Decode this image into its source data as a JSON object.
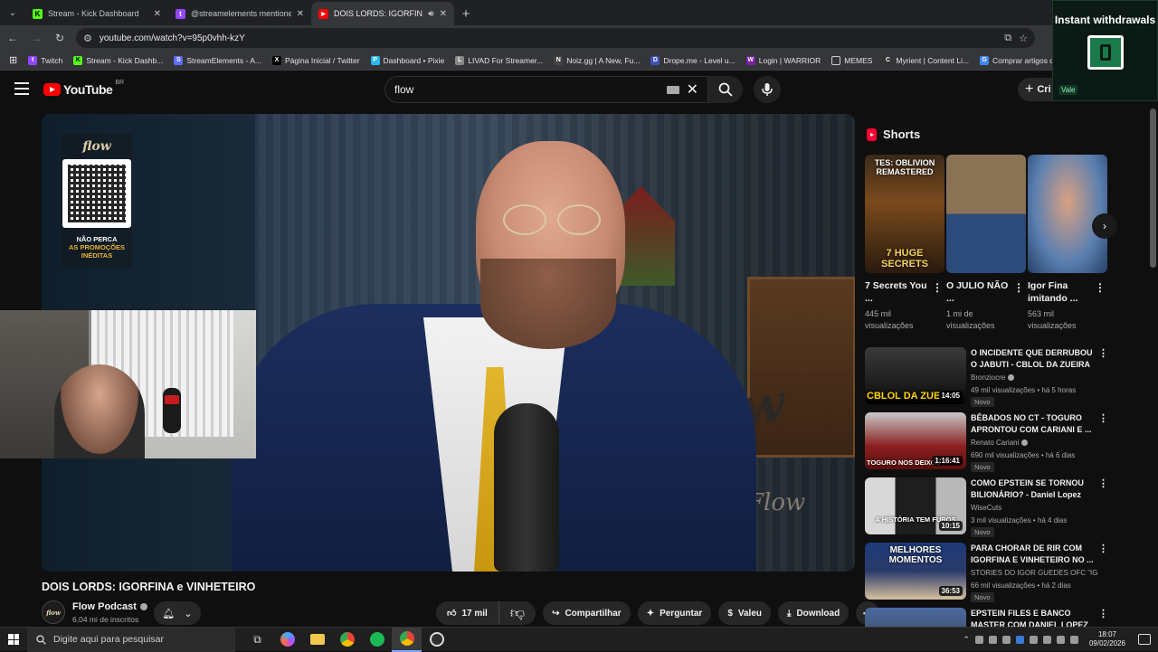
{
  "browser": {
    "tabs": [
      {
        "title": "Stream - Kick Dashboard",
        "icon": "kick-icon",
        "color": "#53fc18",
        "glyph": "K"
      },
      {
        "title": "@streamelements mentione",
        "icon": "twitch-icon",
        "color": "#9146ff",
        "glyph": "t"
      },
      {
        "title": "DOIS LORDS: IGORFINA e V",
        "icon": "youtube-icon",
        "color": "#ff0000",
        "glyph": "▶"
      }
    ],
    "url": "youtube.com/watch?v=95p0vhh-kzY",
    "bookmarks": [
      {
        "label": "Twitch",
        "color": "#9146ff",
        "glyph": "t"
      },
      {
        "label": "Stream - Kick Dashb...",
        "color": "#53fc18",
        "glyph": "K"
      },
      {
        "label": "StreamElements - A...",
        "color": "#5b6cff",
        "glyph": "S"
      },
      {
        "label": "Página Inicial / Twitter",
        "color": "#000000",
        "glyph": "X"
      },
      {
        "label": "Dashboard • Pixie",
        "color": "#29b6f6",
        "glyph": "P"
      },
      {
        "label": "LIVAD For Streamer...",
        "color": "#888888",
        "glyph": "L"
      },
      {
        "label": "Noiz.gg | A New, Fu...",
        "color": "#444444",
        "glyph": "N"
      },
      {
        "label": "Drope.me - Level u...",
        "color": "#3f51b5",
        "glyph": "D"
      },
      {
        "label": "Login | WARRIOR",
        "color": "#7b1fa2",
        "glyph": "W"
      },
      {
        "label": "MEMES",
        "color": "#5f6368",
        "glyph": "▭"
      },
      {
        "label": "Myrient | Content Li...",
        "color": "#333333",
        "glyph": "C"
      },
      {
        "label": "Comprar artigos de...",
        "color": "#4285f4",
        "glyph": "G"
      }
    ]
  },
  "youtube": {
    "logo": "YouTube",
    "country": "BR",
    "search_value": "flow",
    "create_label": "Cri"
  },
  "overlay": {
    "title": "Instant withdrawals",
    "tag": "Vale"
  },
  "video": {
    "promo_logo": "flow",
    "promo_line1": "NÃO PERCA",
    "promo_line2": "AS PROMOÇÕES",
    "promo_line3": "INÉDITAS",
    "watermark": "Flow",
    "title": "DOIS LORDS: IGORFINA e VINHETEIRO",
    "channel": "Flow Podcast",
    "channel_avatar": "flow",
    "subscribers": "6,04 mi de inscritos",
    "likes": "17 mil",
    "share": "Compartilhar",
    "ask": "Perguntar",
    "thanks": "Valeu",
    "download": "Download"
  },
  "sidebar": {
    "shorts_label": "Shorts",
    "shorts": [
      {
        "title": "7 Secrets You ...",
        "views_line1": "445 mil",
        "views_line2": "visualizações",
        "thumb_top": "TES: OBLIVION REMASTERED",
        "thumb_bottom": "7 HUGE SECRETS",
        "bg": "#7a4a1c"
      },
      {
        "title": "O JULIO NÃO ...",
        "views_line1": "1 mi de",
        "views_line2": "visualizações",
        "thumb_top": "",
        "thumb_bottom": "",
        "bg": "#6b5a3e"
      },
      {
        "title": "Igor Fina imitando ...",
        "views_line1": "563 mil",
        "views_line2": "visualizações",
        "thumb_top": "",
        "thumb_bottom": "",
        "bg": "#3a6aa0"
      }
    ],
    "videos": [
      {
        "title": "O INCIDENTE QUE DERRUBOU O JABUTI - CBLOL DA ZUEIRA",
        "channel": "Bronziocre",
        "verified": true,
        "views": "49 mil visualizações • há 5 horas",
        "badge": "Novo",
        "duration": "14:05",
        "thumb_text": "CBLOL DA ZUE",
        "bg": "#2a2a2a"
      },
      {
        "title": "BÊBADOS NO CT - TOGURO APRONTOU COM CARIANI E ...",
        "channel": "Renato Cariani",
        "verified": true,
        "views": "690 mil visualizações • há 6 dias",
        "badge": "Novo",
        "duration": "1:16:41",
        "thumb_text": "TOGURO NOS DEIXOU",
        "bg": "#8a1f1f"
      },
      {
        "title": "COMO EPSTEIN SE TORNOU BILIONÁRIO? - Daniel Lopez",
        "channel": "WiseCuts",
        "verified": false,
        "views": "3 mil visualizações • há 4 dias",
        "badge": "Novo",
        "duration": "10:15",
        "thumb_text": "A HISTÓRIA TEM FUROS",
        "bg": "#1e1e1e"
      },
      {
        "title": "PARA CHORAR DE RIR COM IGORFINA E VINHETEIRO NO ...",
        "channel": "STORIES DO IGOR GUEDES OFC \"IGORFI...",
        "verified": false,
        "views": "66 mil visualizações • há 2 dias",
        "badge": "Novo",
        "duration": "36:53",
        "thumb_text": "MELHORES MOMENTOS",
        "bg": "#2a3b6a"
      },
      {
        "title": "EPSTEIN FILES E BANCO MASTER COM DANIEL LOPEZ",
        "channel": "",
        "verified": false,
        "views": "",
        "badge": "",
        "duration": "",
        "thumb_text": "",
        "bg": "#3a3a3a"
      }
    ]
  },
  "taskbar": {
    "search_placeholder": "Digite aqui para pesquisar",
    "time": "18:07",
    "date": "09/02/2026"
  },
  "colors": {
    "accent": "#ff0000",
    "background": "#0f0f0f"
  }
}
